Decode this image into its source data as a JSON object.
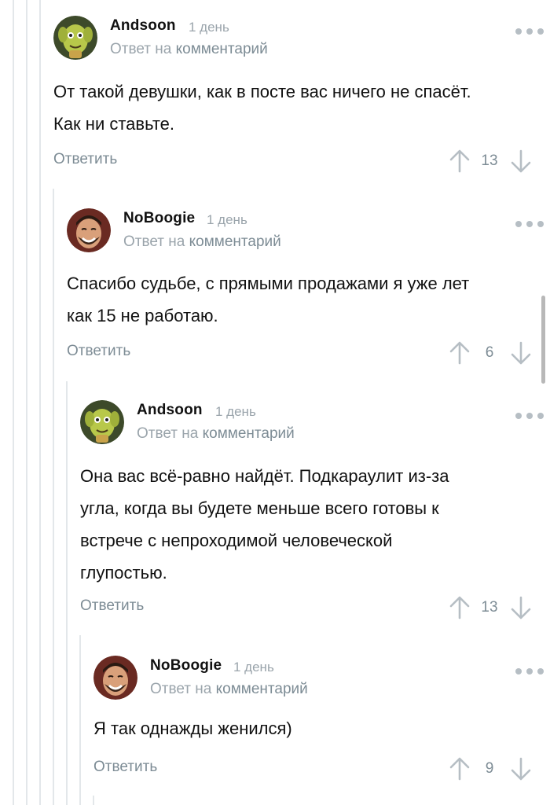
{
  "colors": {
    "thread_line": "#e3e7ea",
    "muted_text": "#9aa4ab",
    "link_text": "#7d8c95",
    "icon": "#b6bec4"
  },
  "comments": [
    {
      "author": "Andsoon",
      "time": "1 день",
      "reply_prefix": "Ответ на",
      "reply_link": "комментарий",
      "lines": [
        "От такой девушки, как в посте вас ничего не спасёт.",
        "Как ни ставьте."
      ],
      "reply_label": "Ответить",
      "score": "13",
      "avatar": "goblin-avatar"
    },
    {
      "author": "NoBoogie",
      "time": "1 день",
      "reply_prefix": "Ответ на",
      "reply_link": "комментарий",
      "lines": [
        "Спасибо судьбе, с прямыми продажами я уже лет",
        "как 15 не работаю."
      ],
      "reply_label": "Ответить",
      "score": "6",
      "avatar": "laughing-man-avatar"
    },
    {
      "author": "Andsoon",
      "time": "1 день",
      "reply_prefix": "Ответ на",
      "reply_link": "комментарий",
      "lines": [
        "Она вас всё-равно найдёт. Подкараулит из-за",
        "угла, когда вы будете меньше всего готовы к",
        "встрече с непроходимой человеческой",
        "глупостью."
      ],
      "reply_label": "Ответить",
      "score": "13",
      "avatar": "goblin-avatar"
    },
    {
      "author": "NoBoogie",
      "time": "1 день",
      "reply_prefix": "Ответ на",
      "reply_link": "комментарий",
      "lines": [
        "Я так однажды женился)"
      ],
      "reply_label": "Ответить",
      "score": "9",
      "avatar": "laughing-man-avatar"
    }
  ]
}
